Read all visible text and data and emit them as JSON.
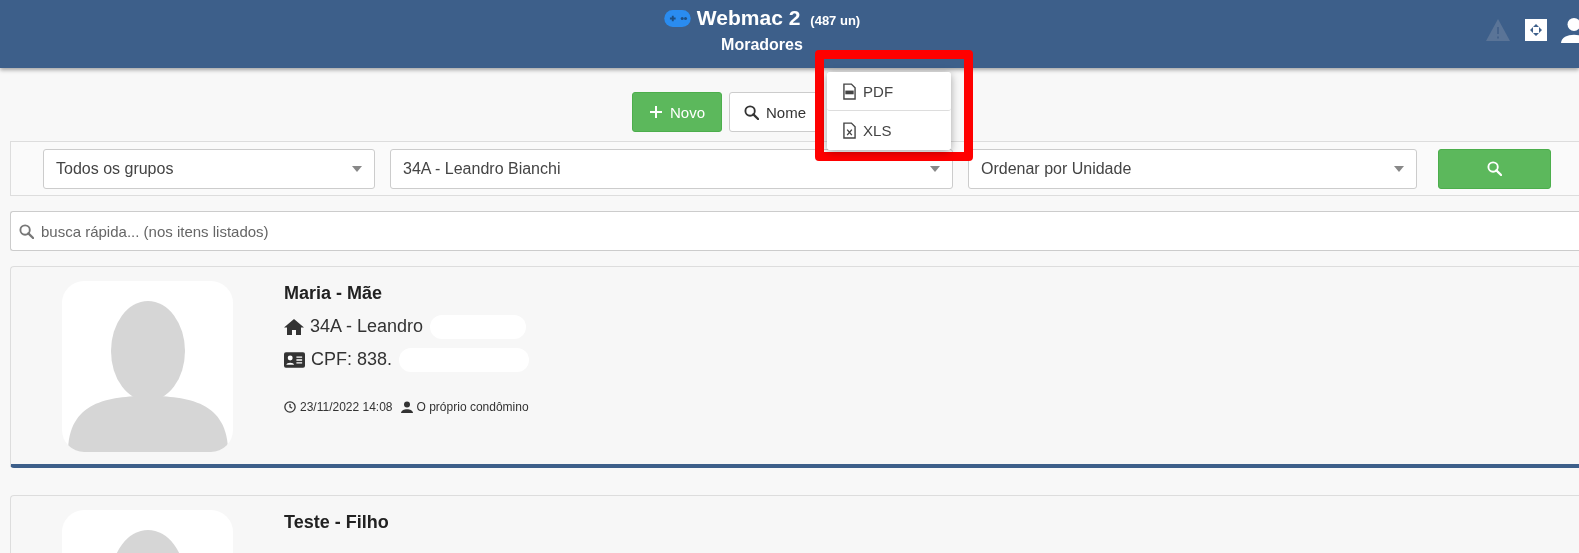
{
  "header": {
    "app_name": "Webmac 2",
    "unit_count": "(487 un)",
    "page_title": "Moradores"
  },
  "toolbar": {
    "buttons": [
      {
        "kind": "primary",
        "label": "Novo"
      },
      {
        "kind": "search",
        "label": "Nome"
      }
    ]
  },
  "export_menu": {
    "items": [
      {
        "kind": "pdf",
        "label": "PDF"
      },
      {
        "kind": "xls",
        "label": "XLS"
      }
    ]
  },
  "filters": {
    "selects": [
      {
        "value": "Todos os grupos"
      },
      {
        "value": "34A - Leandro Bianchi"
      },
      {
        "value": "Ordenar por Unidade"
      }
    ]
  },
  "quick_search": {
    "placeholder": "busca rápida... (nos itens listados)"
  },
  "residents": [
    {
      "name": "Maria - Mãe",
      "unit": "34A - Leandro",
      "cpf": "CPF: 838.",
      "date": "23/11/2022 14:08",
      "registered_by": "O próprio condômino",
      "redacted": true
    },
    {
      "name": "Teste - Filho",
      "redacted": false
    }
  ]
}
